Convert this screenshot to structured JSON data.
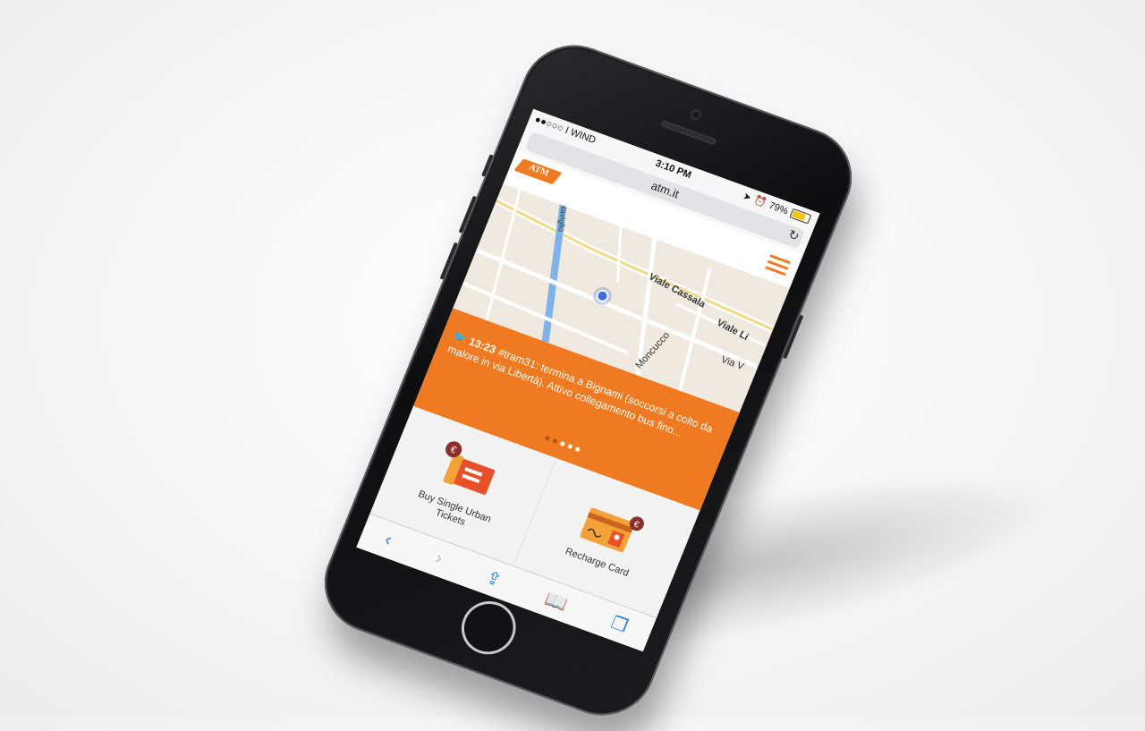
{
  "status_bar": {
    "carrier": "●●○○○ I WIND",
    "time": "3:10 PM",
    "battery": "79%"
  },
  "browser": {
    "url": "atm.it"
  },
  "site": {
    "logo": "ATM"
  },
  "map": {
    "labels": [
      "Viale Cassala",
      "Viale Li",
      "Via V",
      "Moncucco",
      "Naviglio"
    ]
  },
  "tweet": {
    "time": "13:23",
    "text": "#tram31: termina a Bignami (soccorsi a colto da malore in via Libertà). Attivo collegamento bus fino..."
  },
  "tiles": [
    {
      "label": "Buy Single Urban Tickets"
    },
    {
      "label": "Recharge Card"
    }
  ],
  "colors": {
    "brand": "#f07a22"
  }
}
